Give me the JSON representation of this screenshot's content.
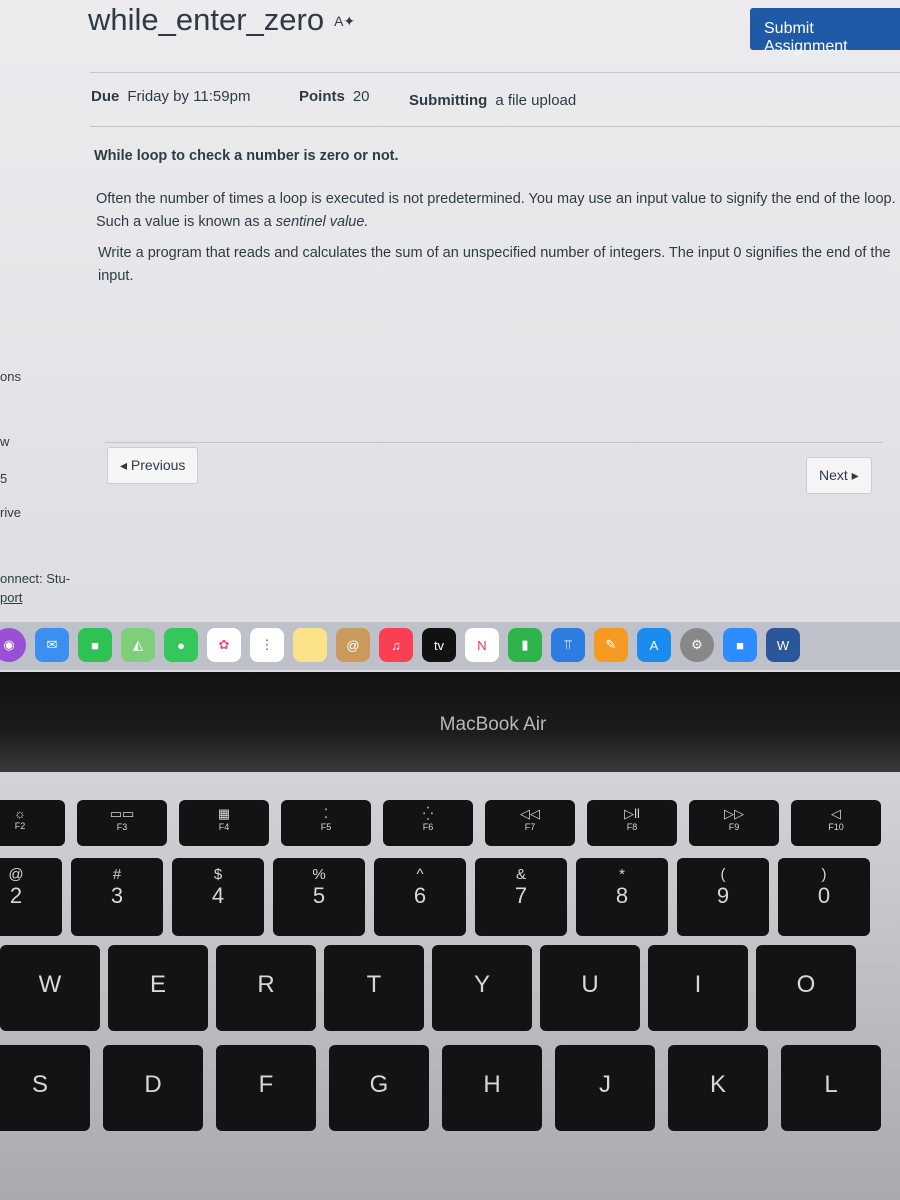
{
  "assignment": {
    "title": "while_enter_zero",
    "title_icon": "ai-sparkle-icon",
    "submit_label": "Submit Assignment",
    "due_label": "Due",
    "due_value": "Friday by 11:59pm",
    "points_label": "Points",
    "points_value": "20",
    "submitting_label": "Submitting",
    "submitting_value": "a file upload",
    "heading": "While loop to check a number is zero or not.",
    "para1_a": "Often the number of times a loop is executed is not predetermined. You may use an input value to signify the end of the loop. Such a value is known as a ",
    "para1_em": "sentinel value.",
    "para2": "Write a program that reads and calculates the sum of an unspecified number of integers. The input 0 signifies the end of the input.",
    "prev_label": "◂ Previous",
    "next_label": "Next ▸",
    "accent": "#1f5aa6"
  },
  "sidebar_fragments": [
    "ons",
    "w",
    "5",
    "rive",
    "onnect: Stu-",
    "port"
  ],
  "dock": [
    "podcasts",
    "mail",
    "facetime",
    "maps",
    "messages",
    "photos",
    "reminders",
    "notes",
    "contacts",
    "music",
    "tv",
    "news",
    "numbers",
    "keynote",
    "pages",
    "app-store",
    "system-preferences",
    "zoom",
    "word"
  ],
  "dock_tv_label": "tv",
  "dock_word_label": "W",
  "laptop_brand": "MacBook Air",
  "keyboard": {
    "fn": [
      {
        "g": "☼",
        "l": "F2"
      },
      {
        "g": "▭▭",
        "l": "F3"
      },
      {
        "g": "▦",
        "l": "F4"
      },
      {
        "g": "⁚",
        "l": "F5"
      },
      {
        "g": "⁛",
        "l": "F6"
      },
      {
        "g": "◁◁",
        "l": "F7"
      },
      {
        "g": "▷ll",
        "l": "F8"
      },
      {
        "g": "▷▷",
        "l": "F9"
      },
      {
        "g": "◁",
        "l": "F10"
      }
    ],
    "num": [
      {
        "s": "@",
        "m": "2"
      },
      {
        "s": "#",
        "m": "3"
      },
      {
        "s": "$",
        "m": "4"
      },
      {
        "s": "%",
        "m": "5"
      },
      {
        "s": "^",
        "m": "6"
      },
      {
        "s": "&",
        "m": "7"
      },
      {
        "s": "*",
        "m": "8"
      },
      {
        "s": "(",
        "m": "9"
      },
      {
        "s": ")",
        "m": "0"
      }
    ],
    "row1": [
      "W",
      "E",
      "R",
      "T",
      "Y",
      "U",
      "I",
      "O"
    ],
    "row2": [
      "S",
      "D",
      "F",
      "G",
      "H",
      "J",
      "K",
      "L"
    ]
  }
}
